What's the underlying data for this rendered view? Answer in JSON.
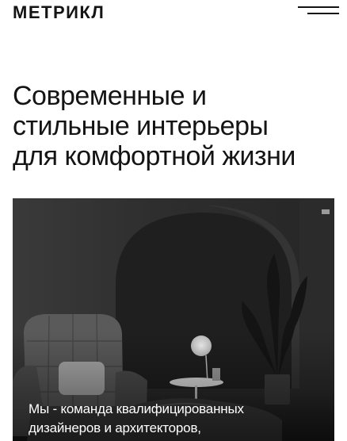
{
  "header": {
    "logo_text": "МЕТРИКЛ",
    "menu_icon": "hamburger-menu-icon"
  },
  "hero": {
    "title_lines": [
      "Современные и",
      "стильные интерьеры",
      "для комфортной жизни"
    ],
    "caption_lines": [
      "Мы - команда квалифицированных",
      "дизайнеров и архитекторов,"
    ]
  },
  "colors": {
    "text": "#141414",
    "background": "#ffffff",
    "image_dark": "#2a2a2a",
    "caption_text": "#ffffff"
  }
}
